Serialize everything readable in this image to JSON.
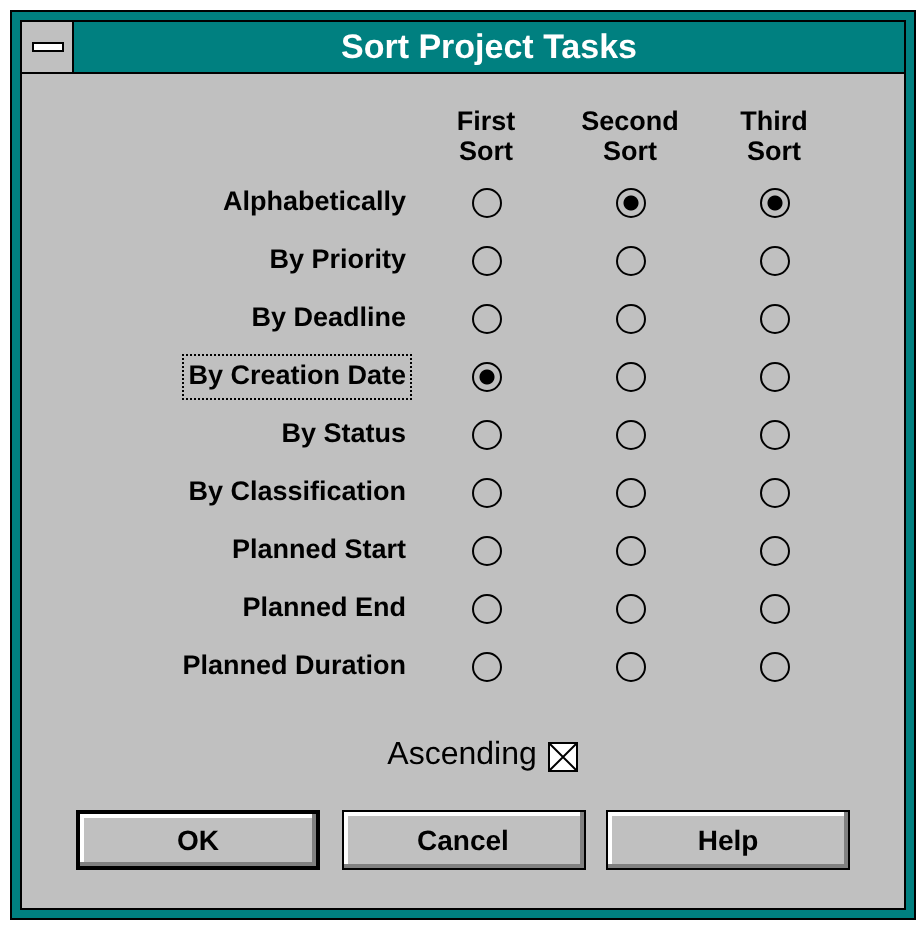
{
  "window": {
    "title": "Sort Project Tasks"
  },
  "columns": [
    {
      "label_line1": "First",
      "label_line2": "Sort"
    },
    {
      "label_line1": "Second",
      "label_line2": "Sort"
    },
    {
      "label_line1": "Third",
      "label_line2": "Sort"
    }
  ],
  "rows": [
    {
      "label": "Alphabetically",
      "focused": false,
      "options": [
        {
          "selected": false
        },
        {
          "selected": true
        },
        {
          "selected": true
        }
      ]
    },
    {
      "label": "By Priority",
      "focused": false,
      "options": [
        {
          "selected": false
        },
        {
          "selected": false
        },
        {
          "selected": false
        }
      ]
    },
    {
      "label": "By Deadline",
      "focused": false,
      "options": [
        {
          "selected": false
        },
        {
          "selected": false
        },
        {
          "selected": false
        }
      ]
    },
    {
      "label": "By Creation Date",
      "focused": true,
      "options": [
        {
          "selected": true
        },
        {
          "selected": false
        },
        {
          "selected": false
        }
      ]
    },
    {
      "label": "By Status",
      "focused": false,
      "options": [
        {
          "selected": false
        },
        {
          "selected": false
        },
        {
          "selected": false
        }
      ]
    },
    {
      "label": "By Classification",
      "focused": false,
      "options": [
        {
          "selected": false
        },
        {
          "selected": false
        },
        {
          "selected": false
        }
      ]
    },
    {
      "label": "Planned Start",
      "focused": false,
      "options": [
        {
          "selected": false
        },
        {
          "selected": false
        },
        {
          "selected": false
        }
      ]
    },
    {
      "label": "Planned End",
      "focused": false,
      "options": [
        {
          "selected": false
        },
        {
          "selected": false
        },
        {
          "selected": false
        }
      ]
    },
    {
      "label": "Planned Duration",
      "focused": false,
      "options": [
        {
          "selected": false
        },
        {
          "selected": false
        },
        {
          "selected": false
        }
      ]
    }
  ],
  "ascending": {
    "label": "Ascending",
    "checked": true
  },
  "buttons": [
    {
      "label": "OK",
      "default": true
    },
    {
      "label": "Cancel",
      "default": false
    },
    {
      "label": "Help",
      "default": false
    }
  ]
}
